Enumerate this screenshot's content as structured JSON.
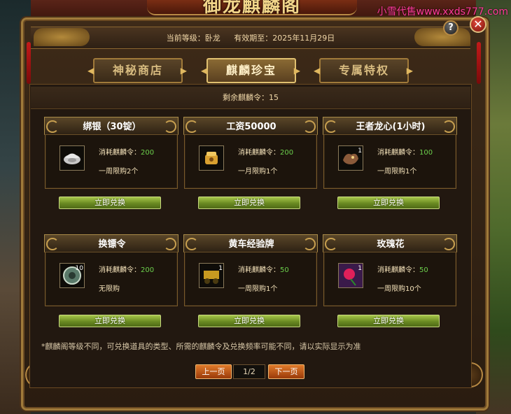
{
  "window": {
    "title": "御龙麒麟阁",
    "watermark": "小雪代售www.xxds777.com"
  },
  "header": {
    "level_label": "当前等级：卧龙",
    "expiry_label": "有效期至：2025年11月29日"
  },
  "controls": {
    "help": "?",
    "close": "✕"
  },
  "tabs": [
    {
      "label": "神秘商店",
      "active": false
    },
    {
      "label": "麒麟珍宝",
      "active": true
    },
    {
      "label": "专属特权",
      "active": false
    }
  ],
  "remaining": "剩余麒麟令：15",
  "cost_prefix": "消耗麒麟令：",
  "items": [
    {
      "name": "绑银（30锭）",
      "cost": "200",
      "limit": "一周限购2个",
      "qty": "",
      "icon": "silver-ingot-icon"
    },
    {
      "name": "工资50000",
      "cost": "200",
      "limit": "一月限购1个",
      "qty": "",
      "icon": "salary-bag-icon"
    },
    {
      "name": "王者龙心(1小时)",
      "cost": "100",
      "limit": "一周限购1个",
      "qty": "1",
      "icon": "dragon-heart-icon"
    },
    {
      "name": "换镖令",
      "cost": "200",
      "limit": "无限购",
      "qty": "10",
      "icon": "escort-token-icon"
    },
    {
      "name": "黄车经验牌",
      "cost": "50",
      "limit": "一周限购1个",
      "qty": "1",
      "icon": "gold-cart-exp-icon"
    },
    {
      "name": "玫瑰花",
      "cost": "50",
      "limit": "一周限购10个",
      "qty": "1",
      "icon": "rose-icon"
    }
  ],
  "exchange_label": "立即兑换",
  "note": "*麒麟阁等级不同，可兑换道具的类型、所需的麒麟令及兑换频率可能不同，请以实际显示为准",
  "pager": {
    "prev": "上一页",
    "page": "1/2",
    "next": "下一页"
  },
  "colors": {
    "accent_gold": "#b88a44",
    "cost_green": "#6cd04c",
    "button_green": "#6a8a22",
    "pager_orange": "#e07a2a"
  }
}
